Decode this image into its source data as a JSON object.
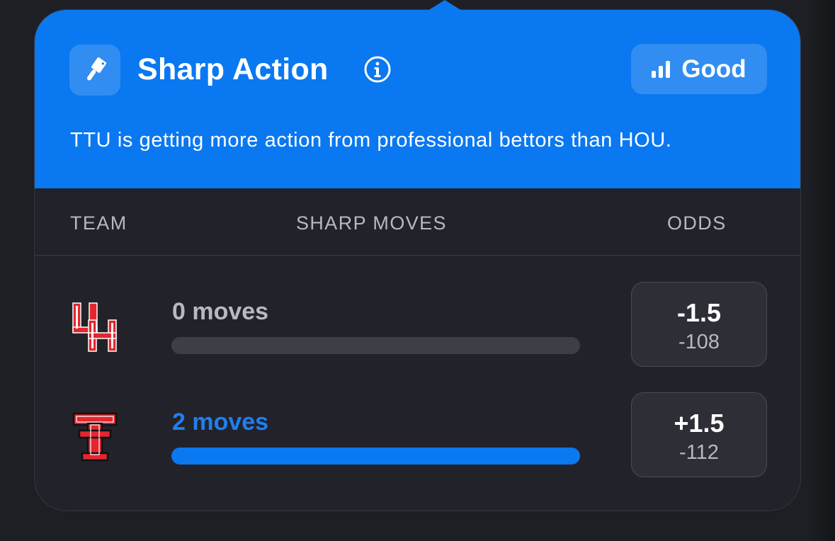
{
  "header": {
    "title": "Sharp Action",
    "icon": "cleaver-icon",
    "rating": {
      "label": "Good",
      "icon": "signal-bars-icon"
    },
    "description": "TTU is getting more action from professional bettors than HOU."
  },
  "columns": {
    "team": "TEAM",
    "moves": "SHARP MOVES",
    "odds": "ODDS"
  },
  "rows": [
    {
      "team_logo": "houston-uh-logo",
      "moves_label": "0 moves",
      "moves_fraction": 0,
      "odds_line": "-1.5",
      "odds_price": "-108",
      "label_color": "#b7b9c2"
    },
    {
      "team_logo": "texas-tech-double-t-logo",
      "moves_label": "2 moves",
      "moves_fraction": 1,
      "odds_line": "+1.5",
      "odds_price": "-112",
      "label_color": "#1f7ff0"
    }
  ],
  "colors": {
    "accent": "#0a78f0",
    "card_bg": "#22232a",
    "track": "#3d3f47",
    "logo_red": "#e3262f"
  }
}
